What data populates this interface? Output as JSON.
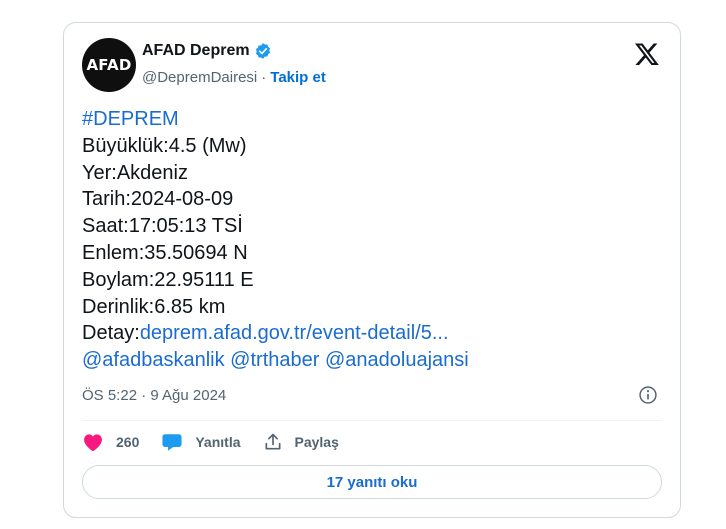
{
  "author": {
    "avatar_text": "AFAD",
    "name": "AFAD Deprem",
    "handle": "@DepremDairesi",
    "separator": "·",
    "follow_label": "Takip et"
  },
  "tweet": {
    "hashtag": "#DEPREM",
    "lines": {
      "magnitude": "Büyüklük:4.5 (Mw)",
      "location": "Yer:Akdeniz",
      "date": "Tarih:2024-08-09",
      "time": "Saat:17:05:13 TSİ",
      "latitude": "Enlem:35.50694 N",
      "longitude": "Boylam:22.95111 E",
      "depth": "Derinlik:6.85 km"
    },
    "detail_prefix": "Detay:",
    "detail_link": "deprem.afad.gov.tr/event-detail/5...",
    "mentions": [
      "@afadbaskanlik",
      "@trthaber",
      "@anadoluajansi"
    ],
    "timestamp": "ÖS 5:22 · 9 Ağu 2024"
  },
  "actions": {
    "like_count": "260",
    "reply_label": "Yanıtla",
    "share_label": "Paylaş"
  },
  "read_replies_label": "17 yanıtı oku",
  "colors": {
    "link": "#1a6cd0",
    "like": "#f91880",
    "verified": "#1d9bf0",
    "reply_icon": "#1d9bf0"
  },
  "icons": [
    "verified-badge-icon",
    "x-logo-icon",
    "info-icon",
    "heart-icon",
    "reply-bubble-icon",
    "share-icon"
  ]
}
